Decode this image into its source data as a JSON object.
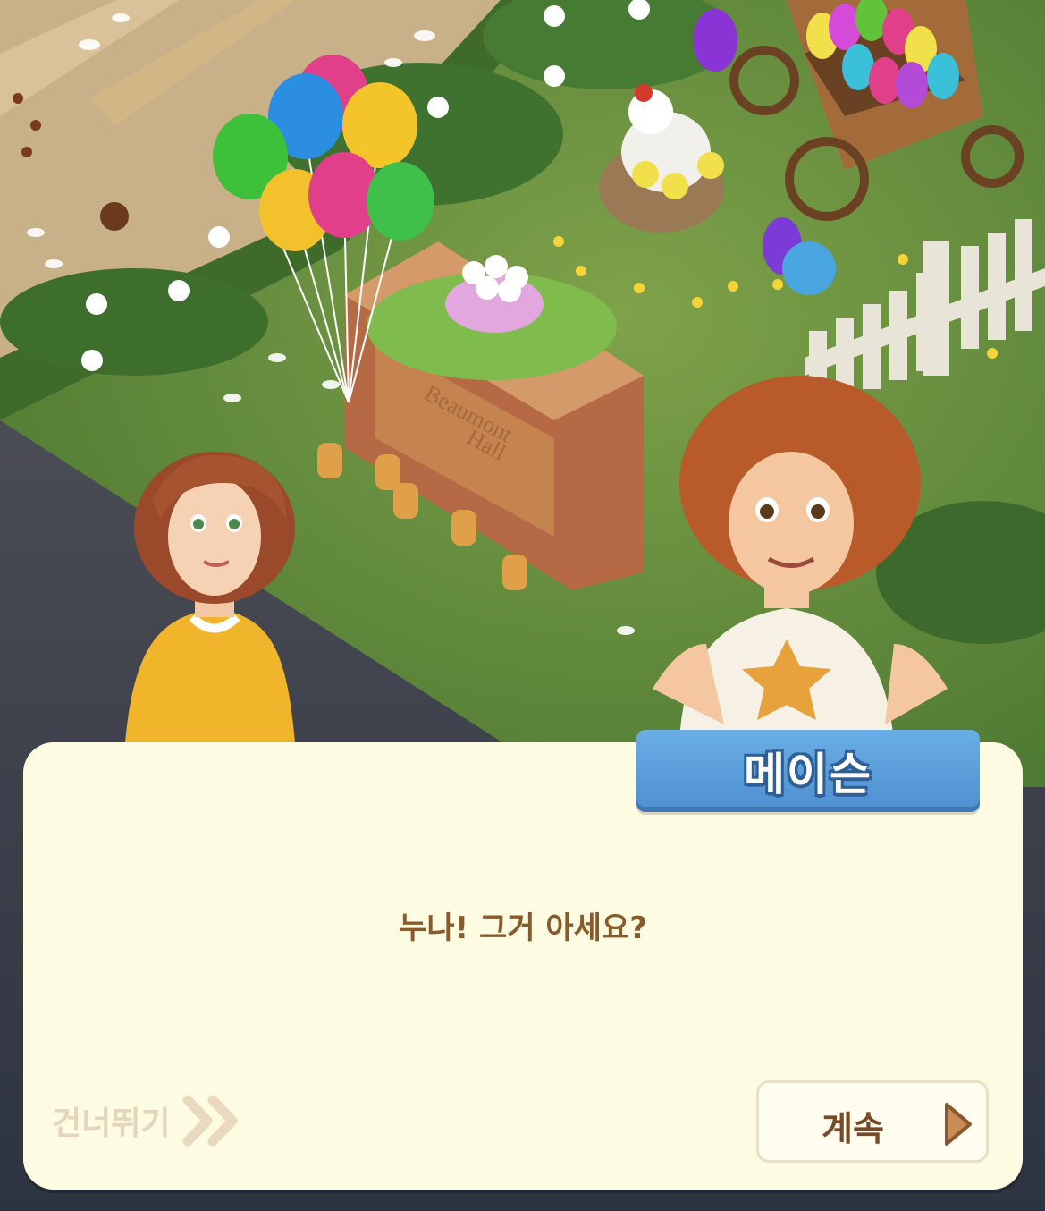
{
  "dialog": {
    "speaker": "메이슨",
    "line": "누나! 그거 아세요?",
    "skip_label": "건너뛰기",
    "continue_label": "계속"
  },
  "scene": {
    "sign_text_line1": "Beaumont",
    "sign_text_line2": "Hall"
  },
  "colors": {
    "dialog_bg": "#fdfbe2",
    "name_tag": "#5b9fdc",
    "speech_text": "#8a5a2b",
    "continue_arrow": "#c98a55"
  },
  "icons": {
    "skip": "double-chevron-right-icon",
    "continue": "play-triangle-icon"
  }
}
